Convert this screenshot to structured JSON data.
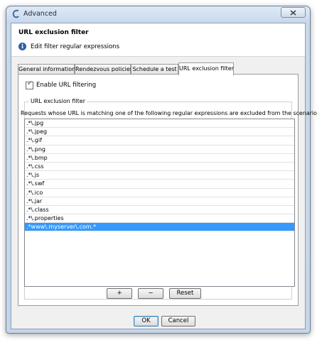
{
  "window": {
    "title": "Advanced"
  },
  "header": {
    "title": "URL exclusion filter",
    "subtitle": "Edit filter regular expressions"
  },
  "tabs": [
    {
      "label": "General information"
    },
    {
      "label": "Rendezvous policies"
    },
    {
      "label": "Schedule a test"
    },
    {
      "label": "URL exclusion filter",
      "active": true
    }
  ],
  "filter": {
    "enable_label": "Enable URL filtering",
    "enabled": true,
    "group_title": "URL exclusion filter",
    "description": "Requests whose URL is matching one of the following regular expressions are excluded from the scenario:",
    "patterns": [
      ".*\\.jpg",
      ".*\\.jpeg",
      ".*\\.gif",
      ".*\\.png",
      ".*\\.bmp",
      ".*\\.css",
      ".*\\.js",
      ".*\\.swf",
      ".*\\.ico",
      ".*\\.jar",
      ".*\\.class",
      ".*\\.properties",
      ".*www\\.myserver\\.com.*"
    ],
    "selected_index": 12,
    "add_label": "+",
    "remove_label": "−",
    "reset_label": "Reset"
  },
  "footer": {
    "ok_label": "OK",
    "cancel_label": "Cancel"
  },
  "colors": {
    "selection": "#3399ff",
    "titlebar": "#c9d9ec"
  }
}
